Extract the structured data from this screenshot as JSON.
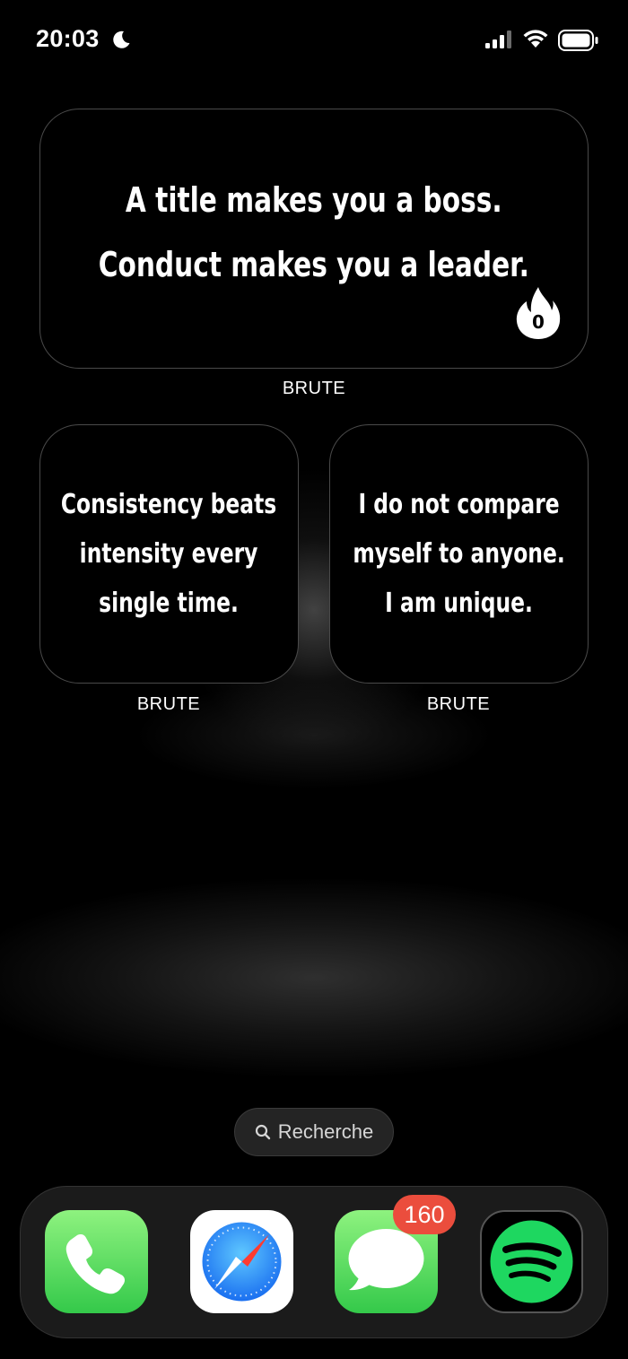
{
  "status_bar": {
    "time": "20:03",
    "icons": [
      "moon-icon",
      "signal-icon",
      "wifi-icon",
      "battery-icon"
    ]
  },
  "widgets": {
    "large": {
      "lines": [
        "A title makes you a boss.",
        "Conduct makes you a leader."
      ],
      "streak_count": "0",
      "label": "BRUTE"
    },
    "small_left": {
      "lines": [
        "Consistency beats",
        "intensity every",
        "single time."
      ],
      "label": "BRUTE"
    },
    "small_right": {
      "lines": [
        "I do not compare",
        "myself to anyone.",
        "I am unique."
      ],
      "label": "BRUTE"
    }
  },
  "search": {
    "label": "Recherche",
    "icon": "search-icon"
  },
  "dock": {
    "apps": [
      {
        "name": "Phone",
        "icon": "phone-icon"
      },
      {
        "name": "Safari",
        "icon": "safari-icon"
      },
      {
        "name": "Messages",
        "icon": "messages-icon",
        "badge": "160"
      },
      {
        "name": "Spotify",
        "icon": "spotify-icon"
      }
    ]
  },
  "colors": {
    "background": "#000000",
    "badge": "#eb4d3d",
    "app_green": "#34c94a",
    "spotify_green": "#1ed760"
  }
}
